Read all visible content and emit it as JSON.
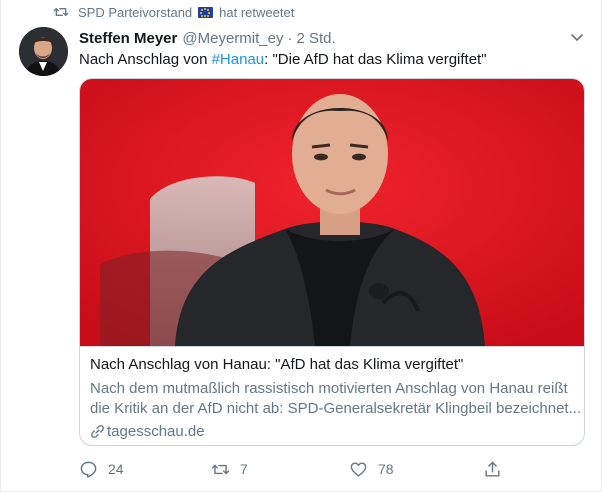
{
  "retweet": {
    "retweeter": "SPD Parteivorstand",
    "suffix": "hat retweetet"
  },
  "tweet": {
    "author_name": "Steffen Meyer",
    "handle": "@Meyermit_ey",
    "separator": "·",
    "timestamp": "2 Std.",
    "text_prefix": "Nach Anschlag von ",
    "hashtag": "#Hanau",
    "text_suffix": ": \"Die AfD hat das Klima vergiftet\""
  },
  "card": {
    "title": "Nach Anschlag von Hanau: \"AfD hat das Klima vergiftet\"",
    "description_line1": "Nach dem mutmaßlich rassistisch motivierten Anschlag von Hanau reißt",
    "description_line2": "die Kritik an der AfD nicht ab: SPD-Generalsekretär Klingbeil bezeichnet...",
    "domain": "tagesschau.de"
  },
  "actions": {
    "replies": "24",
    "retweets": "7",
    "likes": "78"
  },
  "icons": {
    "retweet": "retweet-icon",
    "eu_flag": "eu-flag-icon",
    "caret": "chevron-down-icon",
    "link": "link-icon",
    "reply": "reply-icon",
    "like": "heart-icon",
    "share": "share-icon"
  },
  "colors": {
    "accent": "#1b95e0",
    "muted": "#657786",
    "border": "#ccd6dd",
    "card_background_red": "#e2141f"
  }
}
